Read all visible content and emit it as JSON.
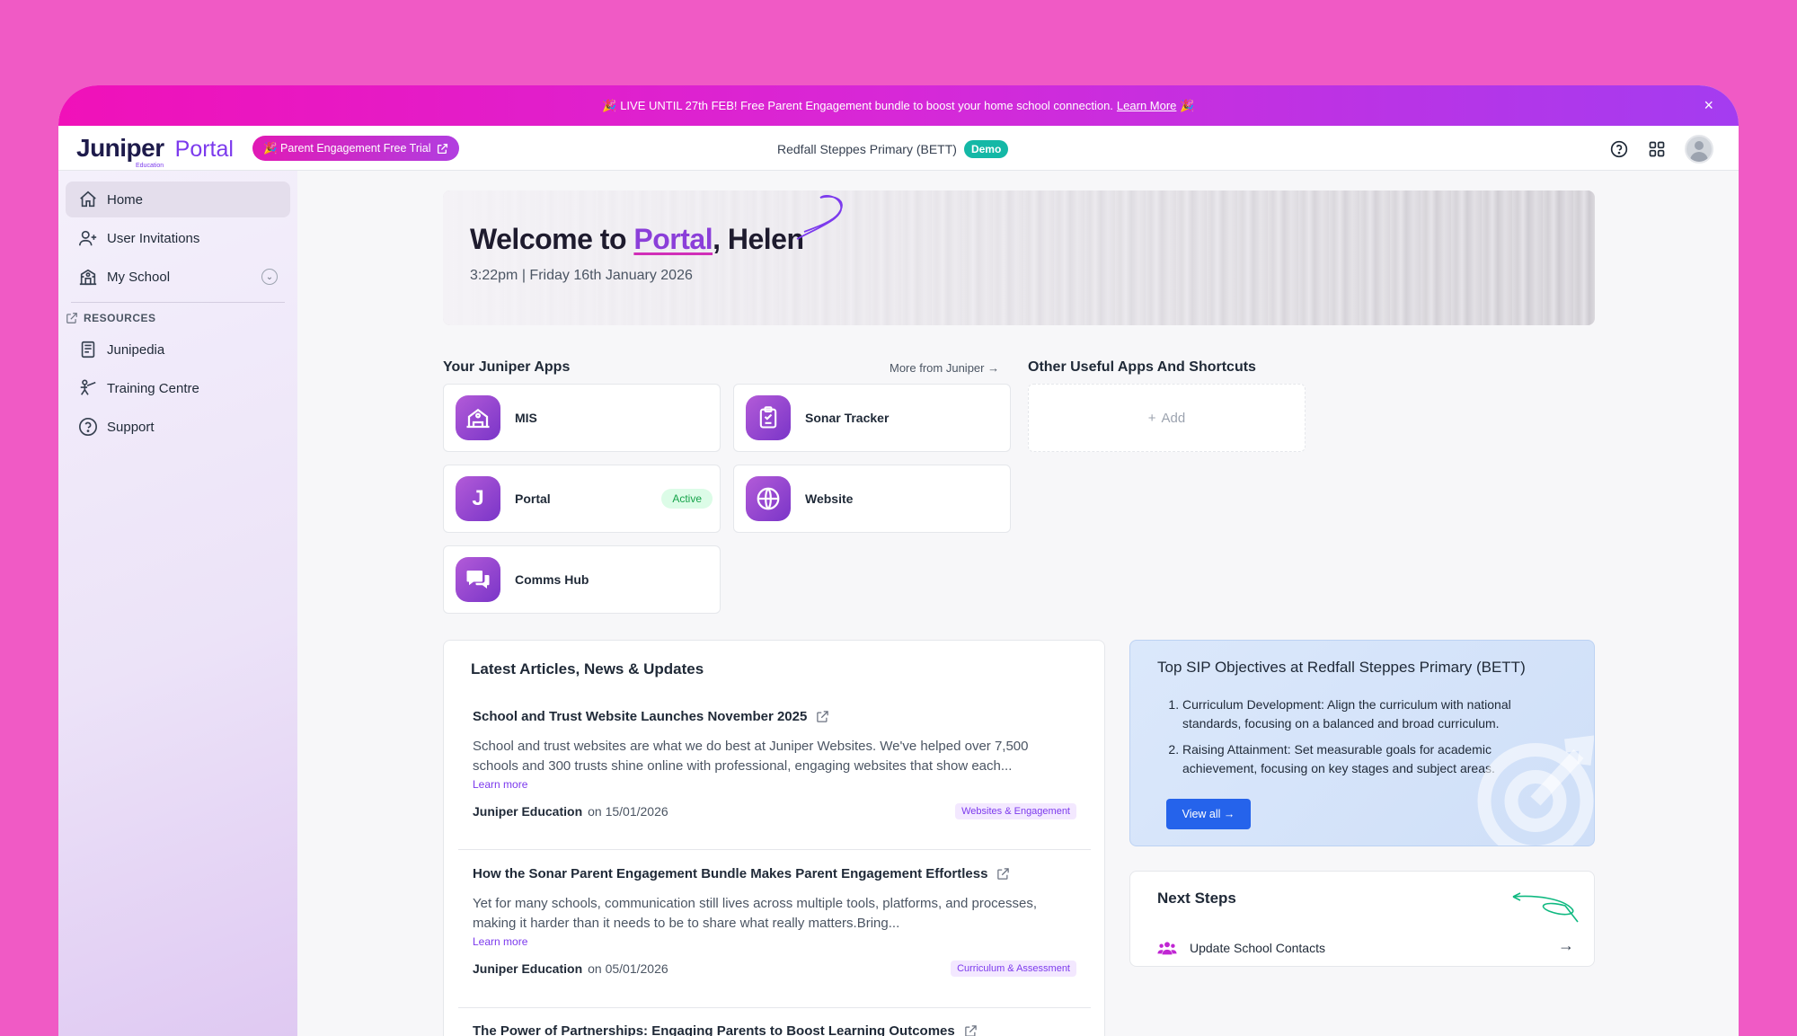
{
  "banner": {
    "text": "🎉 LIVE UNTIL 27th FEB! Free Parent Engagement bundle to boost your home school connection.",
    "learn_more": "Learn More",
    "emoji_end": "🎉",
    "close": "×"
  },
  "header": {
    "logo_main": "Juniper",
    "logo_sub": "Education",
    "logo_product": "Portal",
    "trial_label": "🎉 Parent Engagement Free Trial",
    "school_name": "Redfall Steppes Primary (BETT)",
    "demo_badge": "Demo"
  },
  "sidebar": {
    "items": [
      {
        "label": "Home"
      },
      {
        "label": "User Invitations"
      },
      {
        "label": "My School"
      }
    ],
    "resources_label": "RESOURCES",
    "resources": [
      {
        "label": "Junipedia"
      },
      {
        "label": "Training Centre"
      },
      {
        "label": "Support"
      }
    ]
  },
  "hero": {
    "welcome_prefix": "Welcome to ",
    "welcome_highlight": "Portal",
    "welcome_suffix": ", Helen",
    "datetime": "3:22pm | Friday 16th January 2026"
  },
  "apps": {
    "title": "Your Juniper Apps",
    "more_link": "More from Juniper →",
    "list": [
      {
        "name": "MIS"
      },
      {
        "name": "Sonar Tracker"
      },
      {
        "name": "Portal",
        "badge": "Active",
        "letter": "J"
      },
      {
        "name": "Website"
      },
      {
        "name": "Comms Hub"
      }
    ]
  },
  "shortcuts": {
    "title": "Other Useful Apps And Shortcuts",
    "add_label": "Add"
  },
  "articles": {
    "title": "Latest Articles, News & Updates",
    "list": [
      {
        "title": "School and Trust Website Launches November 2025",
        "body": "School and trust websites are what we do best at Juniper Websites. We've helped over 7,500 schools and 300 trusts shine online with professional, engaging websites that show each...",
        "learn_more": "Learn more",
        "author": "Juniper Education",
        "date": "on 15/01/2026",
        "tag": "Websites & Engagement"
      },
      {
        "title": "How the Sonar Parent Engagement Bundle Makes Parent Engagement Effortless",
        "body": "Yet for many schools, communication still lives across multiple tools, platforms, and processes, making it harder than it needs to be to share what really matters.Bring...",
        "learn_more": "Learn more",
        "author": "Juniper Education",
        "date": "on 05/01/2026",
        "tag": "Curriculum & Assessment"
      },
      {
        "title": "The Power of Partnerships: Engaging Parents to Boost Learning Outcomes"
      }
    ]
  },
  "sip": {
    "title": "Top SIP Objectives at Redfall Steppes Primary (BETT)",
    "objectives": [
      "Curriculum Development: Align the curriculum with national standards, focusing on a balanced and broad curriculum.",
      "Raising Attainment: Set measurable goals for academic achievement, focusing on key stages and subject areas."
    ],
    "view_all": "View all →"
  },
  "next_steps": {
    "title": "Next Steps",
    "items": [
      {
        "label": "Update School Contacts"
      }
    ],
    "arrow": "→"
  },
  "colors": {
    "background": "#f05ac5",
    "accent_purple": "#7c3aed",
    "demo_teal": "#14b8a6",
    "button_blue": "#2563eb",
    "active_green": "#16a34a"
  }
}
